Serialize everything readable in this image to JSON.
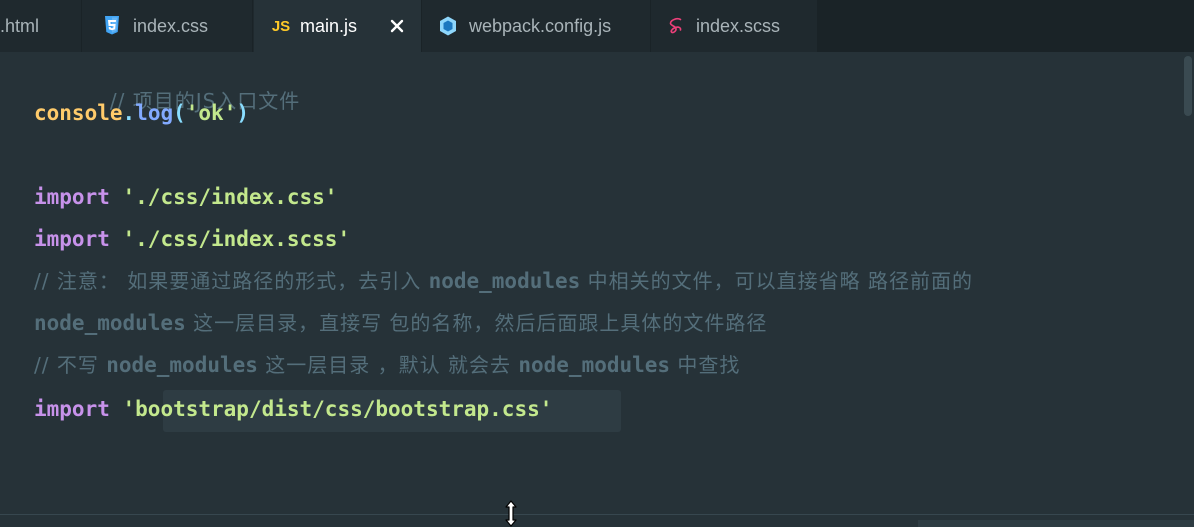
{
  "tabs": [
    {
      "label": ".html",
      "icon": "html-file-icon",
      "active": false
    },
    {
      "label": "index.css",
      "icon": "css3-file-icon",
      "active": false
    },
    {
      "label": "main.js",
      "icon": "js-file-icon",
      "icon_text": "JS",
      "active": true
    },
    {
      "label": "webpack.config.js",
      "icon": "webpack-hexagon-icon",
      "active": false
    },
    {
      "label": "index.scss",
      "icon": "sass-file-icon",
      "active": false
    }
  ],
  "close_icon": "close-icon",
  "code": {
    "line1": {
      "comment": "// 项目的JS入口文件"
    },
    "line2": {
      "object": "console",
      "dot": ".",
      "method": "log",
      "open": "(",
      "string": "'ok'",
      "close": ")"
    },
    "line4": {
      "keyword": "import",
      "string": "'./css/index.css'"
    },
    "line5": {
      "keyword": "import",
      "string": "'./css/index.scss'"
    },
    "line6": {
      "comment_a": "// 注意： 如果要通过路径的形式，去引入 ",
      "comment_mono": "node_modules",
      "comment_b": " 中相关的文件，可以直接省略 路径前面的"
    },
    "line7": {
      "comment_mono": "node_modules",
      "comment_b": " 这一层目录，直接写 包的名称，然后后面跟上具体的文件路径"
    },
    "line8": {
      "comment_a": "// 不写 ",
      "comment_mono": "node_modules",
      "comment_b": " 这一层目录 ，默认 就会去 ",
      "comment_mono2": "node_modules",
      "comment_c": " 中查找"
    },
    "line9": {
      "keyword": "import",
      "string": "'bootstrap/dist/css/bootstrap.css'"
    }
  },
  "colors": {
    "background": "#263238",
    "comment": "#546e7a",
    "keyword": "#c792ea",
    "string": "#c3e88d",
    "object": "#ffcb6b",
    "method": "#82aaff",
    "punctuation": "#89ddff"
  }
}
